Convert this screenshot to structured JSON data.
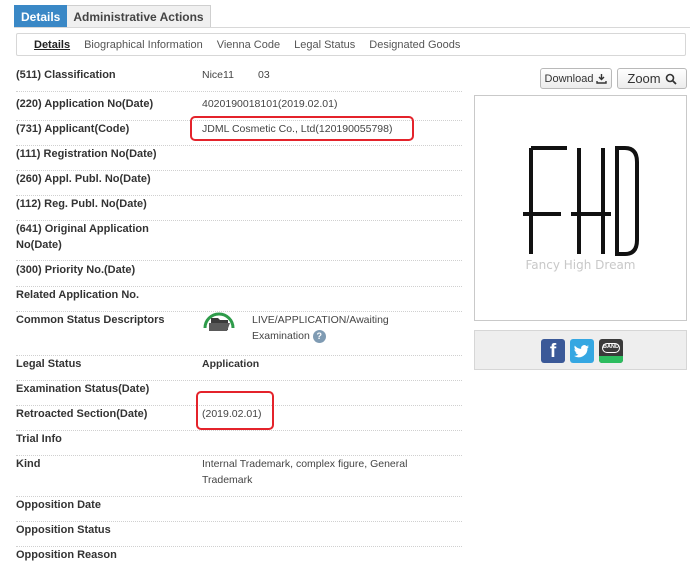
{
  "tabs": {
    "details": "Details",
    "admin": "Administrative Actions"
  },
  "subnav": [
    "Details",
    "Biographical Information",
    "Vienna Code",
    "Legal Status",
    "Designated Goods"
  ],
  "fields": {
    "classification_label": "(511) Classification",
    "classification_value": "Nice11",
    "classification_code": "03",
    "application_no_label": "(220) Application No(Date)",
    "application_no_value": "4020190018101(2019.02.01)",
    "applicant_label": "(731) Applicant(Code)",
    "applicant_value": "JDML Cosmetic Co., Ltd(120190055798)",
    "registration_label": "(111) Registration No(Date)",
    "appl_publ_label": "(260) Appl. Publ. No(Date)",
    "reg_publ_label": "(112) Reg. Publ. No(Date)",
    "original_app_label": "(641) Original Application No(Date)",
    "priority_label": "(300) Priority No.(Date)",
    "related_label": "Related Application No.",
    "status_desc_label": "Common Status Descriptors",
    "status_desc_value": "LIVE/APPLICATION/Awaiting Examination",
    "legal_status_label": "Legal Status",
    "legal_status_value": "Application",
    "exam_status_label": "Examination Status(Date)",
    "retroacted_label": "Retroacted Section(Date)",
    "retroacted_value": "(2019.02.01)",
    "trial_info_label": "Trial Info",
    "kind_label": "Kind",
    "kind_value": "Internal Trademark, complex figure, General Trademark",
    "opposition_date_label": "Opposition Date",
    "opposition_status_label": "Opposition Status",
    "opposition_reason_label": "Opposition Reason"
  },
  "panel": {
    "download_label": "Download",
    "zoom_label": "Zoom",
    "mark_text": "FHD",
    "mark_caption": "Fancy High Dream"
  },
  "share": {
    "facebook": "f",
    "band": "BAND"
  },
  "colors": {
    "tab_active": "#3a88c6",
    "highlight": "#e4232b",
    "facebook": "#3b5998",
    "twitter": "#35a7e2"
  },
  "icons": [
    "folder-open-icon",
    "help-icon",
    "download-icon",
    "search-icon",
    "facebook-icon",
    "twitter-icon",
    "band-icon"
  ]
}
